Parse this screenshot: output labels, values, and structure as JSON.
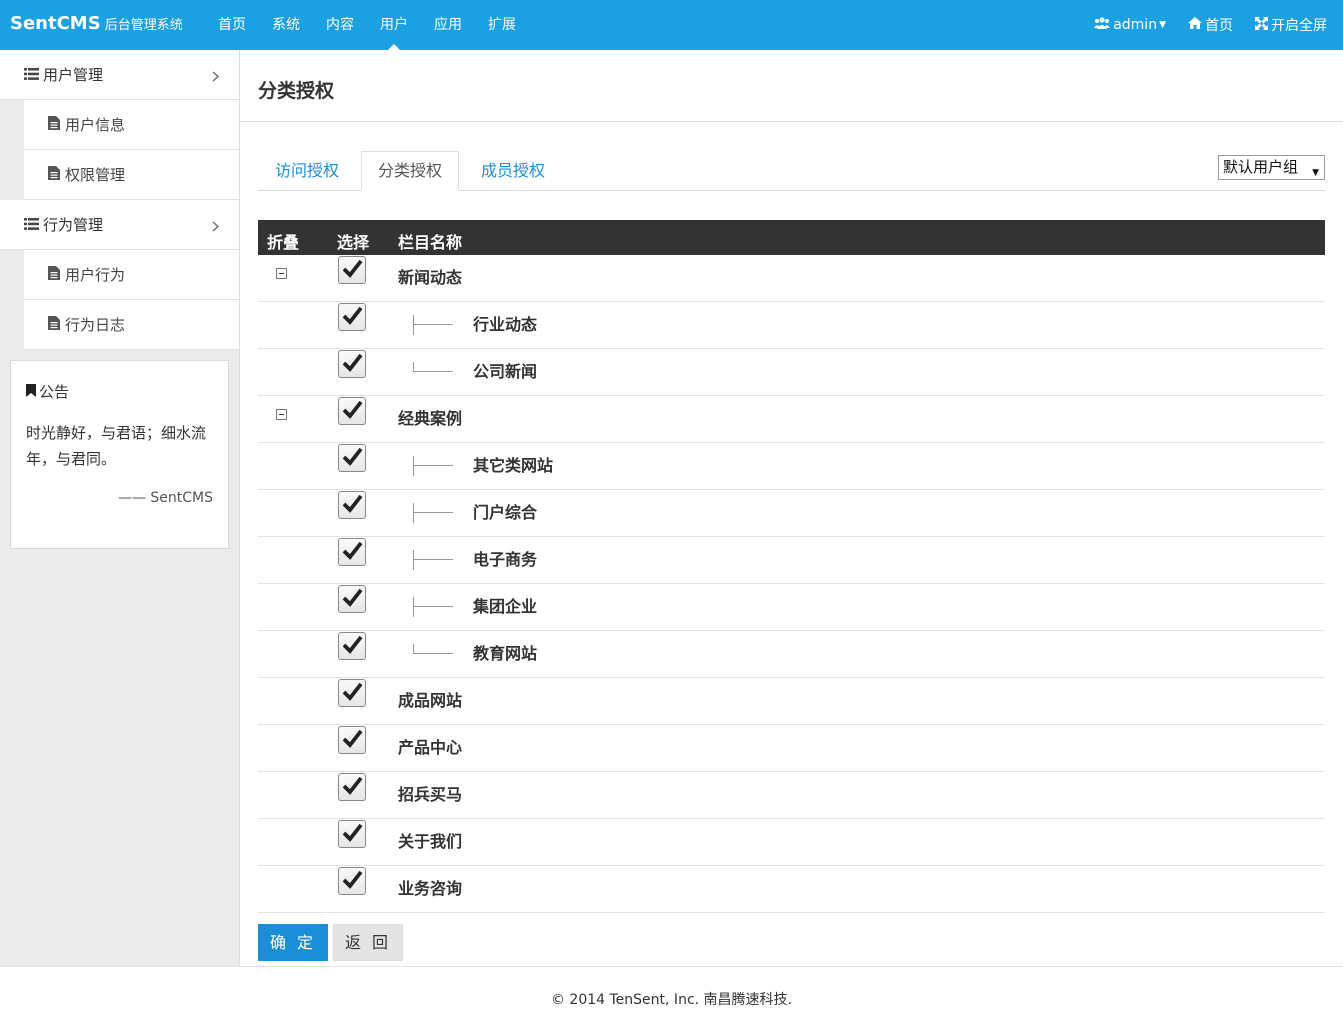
{
  "brand": {
    "name": "SentCMS",
    "subtitle": "后台管理系统"
  },
  "topnav": [
    {
      "label": "首页"
    },
    {
      "label": "系统"
    },
    {
      "label": "内容"
    },
    {
      "label": "用户",
      "active": true
    },
    {
      "label": "应用"
    },
    {
      "label": "扩展"
    }
  ],
  "topright": {
    "user": "admin",
    "home": "首页",
    "fullscreen": "开启全屏"
  },
  "sidebar": {
    "groups": [
      {
        "label": "用户管理",
        "items": [
          {
            "label": "用户信息"
          },
          {
            "label": "权限管理"
          }
        ]
      },
      {
        "label": "行为管理",
        "items": [
          {
            "label": "用户行为"
          },
          {
            "label": "行为日志"
          }
        ]
      }
    ],
    "notice": {
      "title": "公告",
      "text": "时光静好，与君语；细水流年，与君同。",
      "signature": "—— SentCMS"
    }
  },
  "page": {
    "title": "分类授权"
  },
  "tabs": [
    {
      "label": "访问授权"
    },
    {
      "label": "分类授权",
      "active": true
    },
    {
      "label": "成员授权"
    }
  ],
  "group_select": {
    "value": "默认用户组"
  },
  "table": {
    "headers": {
      "collapse": "折叠",
      "select": "选择",
      "name": "栏目名称"
    },
    "rows": [
      {
        "name": "新闻动态",
        "level": 0,
        "collapsible": true,
        "checked": true
      },
      {
        "name": "行业动态",
        "level": 1,
        "checked": true
      },
      {
        "name": "公司新闻",
        "level": 1,
        "last": true,
        "checked": true
      },
      {
        "name": "经典案例",
        "level": 0,
        "collapsible": true,
        "checked": true
      },
      {
        "name": "其它类网站",
        "level": 1,
        "checked": true
      },
      {
        "name": "门户综合",
        "level": 1,
        "checked": true
      },
      {
        "name": "电子商务",
        "level": 1,
        "checked": true
      },
      {
        "name": "集团企业",
        "level": 1,
        "checked": true
      },
      {
        "name": "教育网站",
        "level": 1,
        "last": true,
        "checked": true
      },
      {
        "name": "成品网站",
        "level": 0,
        "checked": true
      },
      {
        "name": "产品中心",
        "level": 0,
        "checked": true
      },
      {
        "name": "招兵买马",
        "level": 0,
        "checked": true
      },
      {
        "name": "关于我们",
        "level": 0,
        "checked": true
      },
      {
        "name": "业务咨询",
        "level": 0,
        "checked": true
      }
    ]
  },
  "buttons": {
    "confirm": "确 定",
    "back": "返 回"
  },
  "footer": {
    "text": "© 2014 TenSent, Inc. 南昌腾速科技."
  },
  "colors": {
    "topbar": "#1ba1e2",
    "primary": "#1a8ed6",
    "table_head": "#333333",
    "sidebar_bg": "#ebebeb"
  }
}
